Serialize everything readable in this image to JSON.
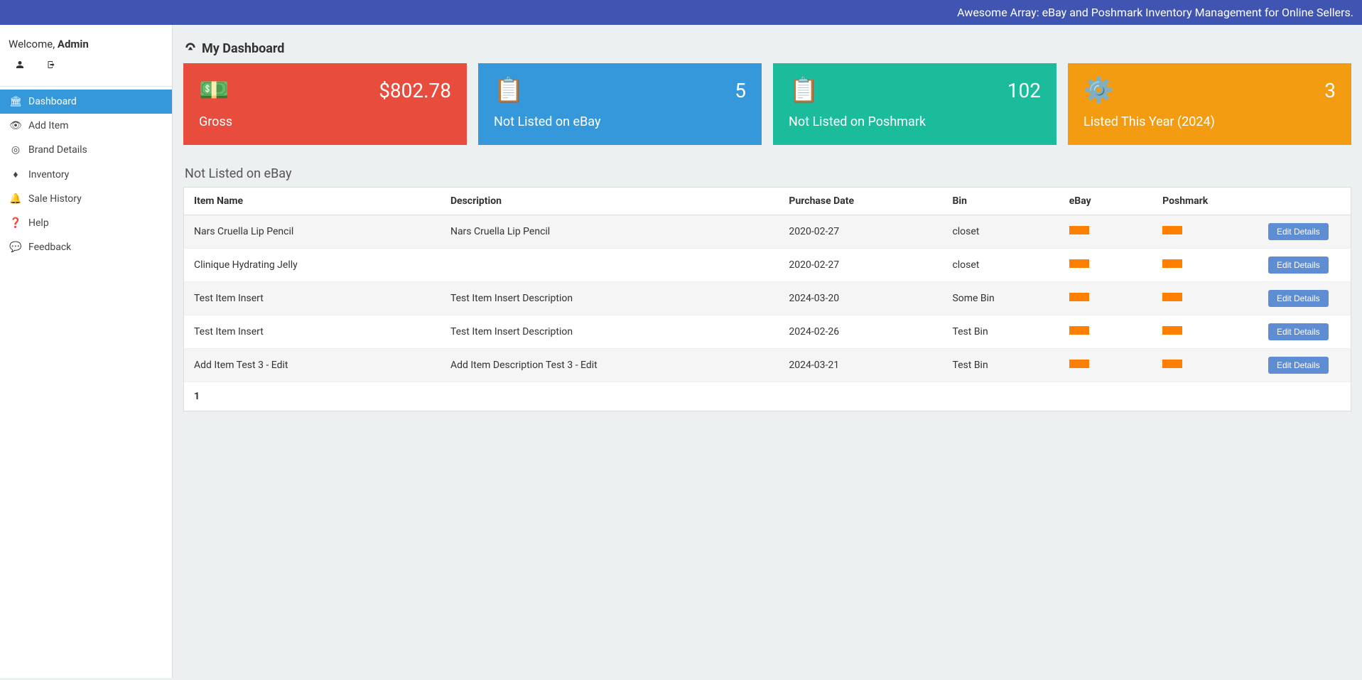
{
  "topbar": {
    "text": "Awesome Array: eBay and Poshmark Inventory Management for Online Sellers."
  },
  "sidebar": {
    "welcome_prefix": "Welcome, ",
    "welcome_user": "Admin",
    "items": [
      {
        "label": "Dashboard",
        "icon": "🏛",
        "active": true
      },
      {
        "label": "Add Item",
        "icon": "👁",
        "active": false
      },
      {
        "label": "Brand Details",
        "icon": "◎",
        "active": false
      },
      {
        "label": "Inventory",
        "icon": "♦",
        "active": false
      },
      {
        "label": "Sale History",
        "icon": "🔔",
        "active": false
      },
      {
        "label": "Help",
        "icon": "❓",
        "active": false
      },
      {
        "label": "Feedback",
        "icon": "💬",
        "active": false
      }
    ]
  },
  "page": {
    "title": "My Dashboard",
    "icon": "📊"
  },
  "cards": [
    {
      "value": "$802.78",
      "label": "Gross",
      "icon": "💵",
      "cls": "c-red"
    },
    {
      "value": "5",
      "label": "Not Listed on eBay",
      "icon": "📋",
      "cls": "c-blue"
    },
    {
      "value": "102",
      "label": "Not Listed on Poshmark",
      "icon": "📋",
      "cls": "c-teal"
    },
    {
      "value": "3",
      "label": "Listed This Year (2024)",
      "icon": "⚙️",
      "cls": "c-orange"
    }
  ],
  "table": {
    "title": "Not Listed on eBay",
    "headers": {
      "item": "Item Name",
      "desc": "Description",
      "date": "Purchase Date",
      "bin": "Bin",
      "ebay": "eBay",
      "posh": "Poshmark"
    },
    "edit_label": "Edit Details",
    "rows": [
      {
        "item": "Nars Cruella Lip Pencil",
        "desc": "Nars Cruella Lip Pencil",
        "date": "2020-02-27",
        "bin": "closet"
      },
      {
        "item": "Clinique Hydrating Jelly",
        "desc": "",
        "date": "2020-02-27",
        "bin": "closet"
      },
      {
        "item": "Test Item Insert",
        "desc": "Test Item Insert Description",
        "date": "2024-03-20",
        "bin": "Some Bin"
      },
      {
        "item": "Test Item Insert",
        "desc": "Test Item Insert Description",
        "date": "2024-02-26",
        "bin": "Test Bin"
      },
      {
        "item": "Add Item Test 3 - Edit",
        "desc": "Add Item Description Test 3 - Edit",
        "date": "2024-03-21",
        "bin": "Test Bin"
      }
    ],
    "page": "1"
  }
}
